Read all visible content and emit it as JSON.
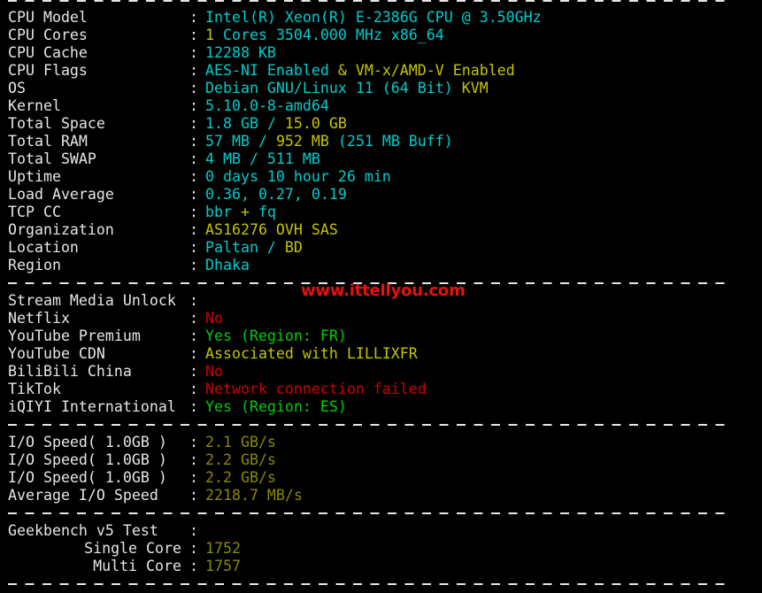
{
  "terminal": {
    "background_color": "#000000",
    "colors": {
      "label": "#e6e6e6",
      "cyan": "#00cdcd",
      "yellow": "#c5c500",
      "olive": "#8a8a00",
      "green": "#00cd00",
      "red": "#cd0000",
      "watermark": "#e81010"
    },
    "separator_char": "-",
    "colon": ":"
  },
  "watermark": {
    "text": "www.ittellyou.com"
  },
  "sections": {
    "system": {
      "rows": [
        {
          "label": "CPU Model",
          "parts": [
            {
              "text": "Intel(R) Xeon(R) E-2386G CPU @ 3.50GHz",
              "color": "cyan"
            }
          ]
        },
        {
          "label": "CPU Cores",
          "parts": [
            {
              "text": "1",
              "color": "yellow"
            },
            {
              "text": " Cores ",
              "color": "cyan"
            },
            {
              "text": "3504.000",
              "color": "cyan"
            },
            {
              "text": " MHz ",
              "color": "cyan"
            },
            {
              "text": "x86_64",
              "color": "cyan"
            }
          ]
        },
        {
          "label": "CPU Cache",
          "parts": [
            {
              "text": "12288 KB",
              "color": "cyan"
            }
          ]
        },
        {
          "label": "CPU Flags",
          "parts": [
            {
              "text": "AES-NI Enabled",
              "color": "cyan"
            },
            {
              "text": " & ",
              "color": "yellow"
            },
            {
              "text": "VM-x/AMD-V Enabled",
              "color": "yellow"
            }
          ]
        },
        {
          "label": "OS",
          "parts": [
            {
              "text": "Debian GNU/Linux 11 (64 Bit) ",
              "color": "cyan"
            },
            {
              "text": "KVM",
              "color": "yellow"
            }
          ]
        },
        {
          "label": "Kernel",
          "parts": [
            {
              "text": "5.10.0-8-amd64",
              "color": "cyan"
            }
          ]
        },
        {
          "label": "Total Space",
          "parts": [
            {
              "text": "1.8 GB ",
              "color": "cyan"
            },
            {
              "text": "/ ",
              "color": "cyan"
            },
            {
              "text": "15.0 GB",
              "color": "yellow"
            }
          ]
        },
        {
          "label": "Total RAM",
          "parts": [
            {
              "text": "57 MB ",
              "color": "cyan"
            },
            {
              "text": "/ ",
              "color": "cyan"
            },
            {
              "text": "952 MB",
              "color": "yellow"
            },
            {
              "text": " (251 MB Buff)",
              "color": "cyan"
            }
          ]
        },
        {
          "label": "Total SWAP",
          "parts": [
            {
              "text": "4 MB / 511 MB",
              "color": "cyan"
            }
          ]
        },
        {
          "label": "Uptime",
          "parts": [
            {
              "text": "0 days 10 hour 26 min",
              "color": "cyan"
            }
          ]
        },
        {
          "label": "Load Average",
          "parts": [
            {
              "text": "0.36, 0.27, 0.19",
              "color": "cyan"
            }
          ]
        },
        {
          "label": "TCP CC",
          "parts": [
            {
              "text": "bbr ",
              "color": "cyan"
            },
            {
              "text": "+",
              "color": "yellow"
            },
            {
              "text": " fq",
              "color": "cyan"
            }
          ]
        },
        {
          "label": "Organization",
          "parts": [
            {
              "text": "AS16276 OVH SAS",
              "color": "yellow"
            }
          ]
        },
        {
          "label": "Location",
          "parts": [
            {
              "text": "Paltan / ",
              "color": "cyan"
            },
            {
              "text": "BD",
              "color": "yellow"
            }
          ]
        },
        {
          "label": "Region",
          "parts": [
            {
              "text": "Dhaka",
              "color": "cyan"
            }
          ]
        }
      ]
    },
    "stream_media": {
      "rows": [
        {
          "label": "Stream Media Unlock",
          "parts": []
        },
        {
          "label": "Netflix",
          "parts": [
            {
              "text": "No",
              "color": "red"
            }
          ]
        },
        {
          "label": "YouTube Premium",
          "parts": [
            {
              "text": "Yes (Region: FR)",
              "color": "green"
            }
          ]
        },
        {
          "label": "YouTube CDN",
          "parts": [
            {
              "text": "Associated with LILLIXFR",
              "color": "yellow"
            }
          ]
        },
        {
          "label": "BiliBili China",
          "parts": [
            {
              "text": "No",
              "color": "red"
            }
          ]
        },
        {
          "label": "TikTok",
          "parts": [
            {
              "text": "Network connection failed",
              "color": "red"
            }
          ]
        },
        {
          "label": "iQIYI International",
          "parts": [
            {
              "text": "Yes (Region: ES)",
              "color": "green"
            }
          ]
        }
      ]
    },
    "io_speed": {
      "rows": [
        {
          "label": "I/O Speed( 1.0GB )",
          "parts": [
            {
              "text": "2.1 GB/s",
              "color": "olive"
            }
          ]
        },
        {
          "label": "I/O Speed( 1.0GB )",
          "parts": [
            {
              "text": "2.2 GB/s",
              "color": "olive"
            }
          ]
        },
        {
          "label": "I/O Speed( 1.0GB )",
          "parts": [
            {
              "text": "2.2 GB/s",
              "color": "olive"
            }
          ]
        },
        {
          "label": "Average I/O Speed",
          "parts": [
            {
              "text": "2218.7 MB/s",
              "color": "olive"
            }
          ]
        }
      ]
    },
    "geekbench": {
      "rows": [
        {
          "label": "Geekbench v5 Test",
          "indent": false,
          "parts": []
        },
        {
          "label": "Single Core",
          "indent": true,
          "parts": [
            {
              "text": "1752",
              "color": "olive"
            }
          ]
        },
        {
          "label": "Multi Core",
          "indent": true,
          "parts": [
            {
              "text": "1757",
              "color": "olive"
            }
          ]
        }
      ]
    }
  }
}
